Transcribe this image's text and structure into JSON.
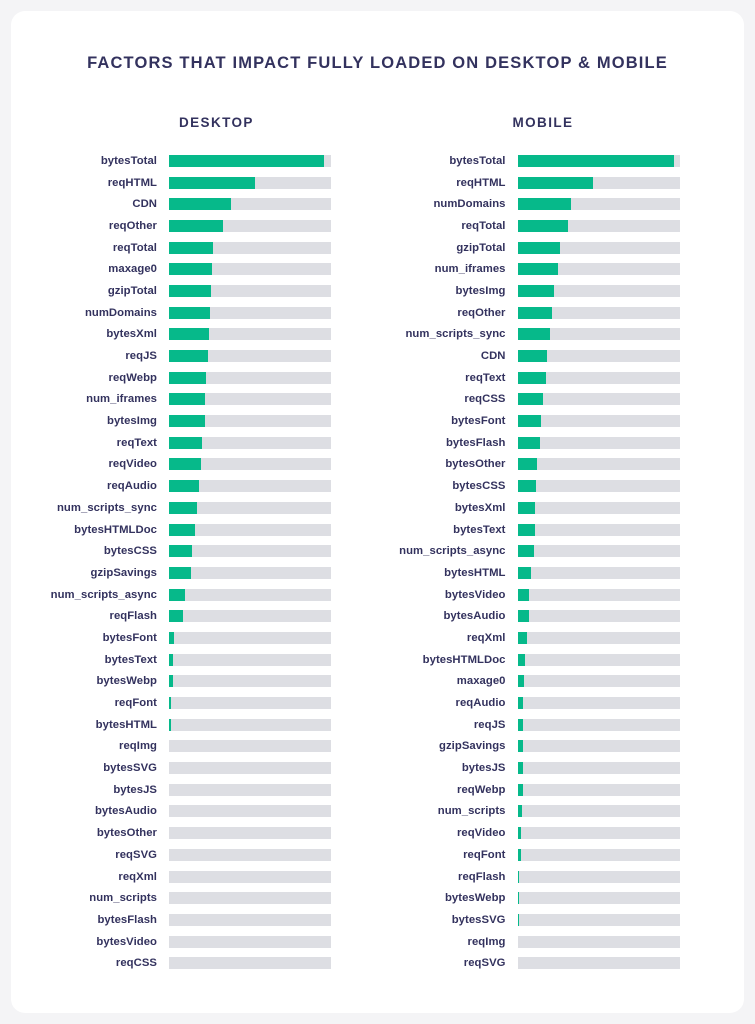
{
  "chart_data": {
    "type": "bar",
    "title": "FACTORS THAT IMPACT FULLY LOADED ON DESKTOP & MOBILE",
    "xlabel": "",
    "ylabel": "",
    "orientation": "horizontal",
    "grid": false,
    "legend": "none",
    "value_unit": "relative correlation strength (0-100, normalized to track width)",
    "xlim": [
      0,
      100
    ],
    "panels": [
      {
        "name": "desktop",
        "label": "DESKTOP",
        "categories": [
          "bytesTotal",
          "reqHTML",
          "CDN",
          "reqOther",
          "reqTotal",
          "maxage0",
          "gzipTotal",
          "numDomains",
          "bytesXml",
          "reqJS",
          "reqWebp",
          "num_iframes",
          "bytesImg",
          "reqText",
          "reqVideo",
          "reqAudio",
          "num_scripts_sync",
          "bytesHTMLDoc",
          "bytesCSS",
          "gzipSavings",
          "num_scripts_async",
          "reqFlash",
          "bytesFont",
          "bytesText",
          "bytesWebp",
          "reqFont",
          "bytesHTML",
          "reqImg",
          "bytesSVG",
          "bytesJS",
          "bytesAudio",
          "bytesOther",
          "reqSVG",
          "reqXml",
          "num_scripts",
          "bytesFlash",
          "bytesVideo",
          "reqCSS"
        ],
        "values": [
          95.7,
          53.1,
          38.3,
          33.3,
          27.2,
          26.5,
          26.0,
          25.3,
          24.7,
          24.1,
          22.8,
          22.2,
          22.2,
          20.4,
          19.8,
          18.5,
          17.3,
          16.0,
          14.2,
          13.6,
          9.9,
          8.6,
          3.1,
          2.5,
          2.5,
          1.2,
          1.2,
          0,
          0,
          0,
          0,
          0,
          0,
          0,
          0,
          0,
          0,
          0
        ]
      },
      {
        "name": "mobile",
        "label": "MOBILE",
        "categories": [
          "bytesTotal",
          "reqHTML",
          "numDomains",
          "reqTotal",
          "gzipTotal",
          "num_iframes",
          "bytesImg",
          "reqOther",
          "num_scripts_sync",
          "CDN",
          "reqText",
          "reqCSS",
          "bytesFont",
          "bytesFlash",
          "bytesOther",
          "bytesCSS",
          "bytesXml",
          "bytesText",
          "num_scripts_async",
          "bytesHTML",
          "bytesVideo",
          "bytesAudio",
          "reqXml",
          "bytesHTMLDoc",
          "maxage0",
          "reqAudio",
          "reqJS",
          "gzipSavings",
          "bytesJS",
          "reqWebp",
          "num_scripts",
          "reqVideo",
          "reqFont",
          "reqFlash",
          "bytesWebp",
          "bytesSVG",
          "reqImg",
          "reqSVG"
        ],
        "values": [
          96.9,
          46.9,
          33.3,
          30.9,
          26.5,
          24.7,
          22.8,
          21.0,
          19.8,
          18.5,
          17.3,
          16.0,
          14.8,
          13.6,
          12.3,
          11.7,
          11.1,
          10.5,
          9.9,
          8.6,
          7.4,
          6.8,
          5.6,
          4.9,
          4.3,
          3.7,
          3.7,
          3.1,
          3.1,
          3.1,
          2.5,
          1.9,
          1.9,
          1.2,
          0.9,
          0.6,
          0,
          0
        ]
      }
    ]
  },
  "colors": {
    "bar_fill": "#06b98a",
    "bar_track": "#dddee3",
    "text": "#33325e",
    "card_background": "#ffffff",
    "page_background": "#f4f4f6"
  }
}
